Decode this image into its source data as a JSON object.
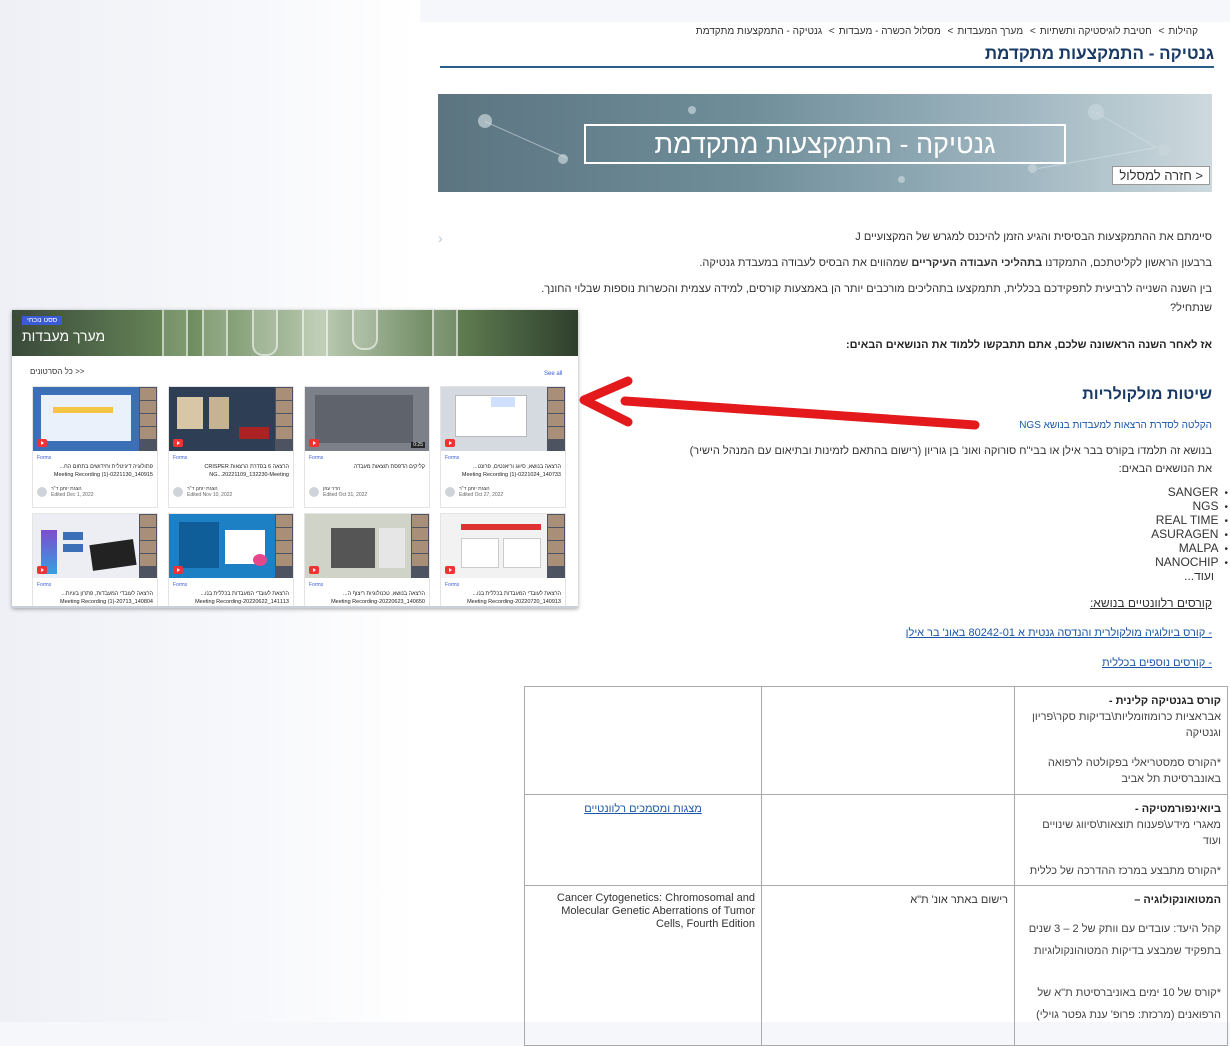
{
  "breadcrumb": [
    "קהילות",
    "חטיבת לוגיסטיקה ותשתיות",
    "מערך המעבדות",
    "מסלול הכשרה - מעבדות",
    "גנטיקה - התמקצעות מתקדמת"
  ],
  "page_title": "גנטיקה - התמקצעות מתקדמת",
  "banner": {
    "title": "גנטיקה - התמקצעות מתקדמת",
    "back_label": "< חזרה למסלול"
  },
  "intro": {
    "p1": "סיימתם את ההתמקצעות הבסיסית והגיע הזמן להיכנס למגרש של המקצועיים J",
    "p2_a": "ברבעון הראשון לקליטתכם, התמקדנו ",
    "p2_bold": "בתהליכי העבודה העיקריים",
    "p2_b": " שמהווים את הבסיס לעבודה במעבדת גנטיקה.",
    "p3": "בין השנה השנייה לרביעית לתפקידכם בכללית, תתמקצעו בתהליכים מורכבים יותר הן באמצעות קורסים, למידה עצמית והכשרות נוספות שבלוי החונך. שנתחיל?",
    "p4": "אז לאחר השנה הראשונה שלכם, אתם תתבקשו ללמוד את הנושאים הבאים:"
  },
  "section": {
    "title": "שיטות מולקולריות",
    "lecture_link": "הקלטה לסדרת הרצאות למעבדות בנושא NGS",
    "course_text_1": "בנושא זה תלמדו בקורס בבר אילן או בבי\"ח סורוקה ואונ' בן גוריון (רישום בהתאם לזמינות ובתיאום עם המנהל הישיר)",
    "course_text_2": "את הנושאים הבאים:",
    "techniques": [
      "SANGER",
      "NGS",
      "REAL TIME",
      "ASURAGEN",
      "MALPA",
      "NANOCHIP"
    ],
    "etc": "ועוד...",
    "relevant_courses": "קורסים רלוונטיים בנושא:",
    "course_link": "- קורס ביולוגיה מולקולרית והנדסה גנטית א 80242-01 באונ' בר אילן",
    "more_courses": "- קורסים נוספים בכללית"
  },
  "table": {
    "rows": [
      {
        "title": "קורס בגנטיקה קלינית -",
        "desc": "אבראציות כרומוזומליות\\בדיקות סקר\\פריון וגנטיקה",
        "note": "*הקורס סמסטריאלי בפקולטה לרפואה באונברסיטת תל אביב",
        "col2": "",
        "col3": ""
      },
      {
        "title": "ביואינפורמטיקה -",
        "desc": "מאגרי מידע\\פענוח תוצאות\\סיווג שינויים ועוד",
        "note": "*הקורס מתבצע במרכז ההדרכה של כללית",
        "col2": "",
        "col3": "מצגות ומסמכים רלוונטיים"
      },
      {
        "title": "המטואונקולוגיה –",
        "desc": "קהל היעד: עובדים עם וותק של 2 – 3 שנים בתפקיד שמבצע בדיקות המטוהונקולוגיות",
        "note": "*קורס של 10 ימים באוניברסיטת ת\"א של הרפואנים (מרכזת: פרופ' ענת גפטר גוילי)",
        "col2": "רישום באתר אונ' ת\"א",
        "col3": "Cancer Cytogenetics: Chromosomal and Molecular Genetic Aberrations of Tumor Cells, Fourth Edition"
      }
    ]
  },
  "overlay": {
    "badge": "ססט נוכחי",
    "title": "מערך מעבדות",
    "all_videos": "<< כל הסרטונים",
    "see_all": "See all",
    "cards": [
      {
        "tag": "Forms",
        "title": "הרצאה בנושא, סיווג וריאנטים, פרונט... 140733_0221024-Meeting Recording (1)",
        "author": "הצגת יוחנן ד\"ר",
        "edited": "Edited Oct 27, 2022",
        "duration": "",
        "thumb": "#d5d9e0"
      },
      {
        "tag": "Forms",
        "title": "קליקים הדפסת תוצאות מעבדה",
        "author": "הדר עוזן",
        "edited": "Edited Oct 31, 2022",
        "duration": "0:25",
        "thumb": "#7c8088"
      },
      {
        "tag": "Forms",
        "title": "הרצאה 6 בסדרת הרצאות CRISPER NG...20221109_132230-Meeting",
        "author": "הצגת יוחנן ד\"ר",
        "edited": "Edited Nov 10, 2022",
        "duration": "",
        "thumb": "#2e3e55"
      },
      {
        "tag": "Forms",
        "title": "פתולוגיה דיגיטלית וחידושים בתחום הח... 140915_0221130-Meeting Recording (1)",
        "author": "הצגת יוחנן ד\"ר",
        "edited": "Edited Dec 1, 2022",
        "duration": "",
        "thumb": "#3b6fb6"
      },
      {
        "tag": "Forms",
        "title": "הרצאת לעובדי המעבדות בכללית בנו... 140913_20220720-Meeting Recording",
        "author": "",
        "edited": "",
        "duration": "",
        "thumb": "#f2f2f2"
      },
      {
        "tag": "Forms",
        "title": "הרצאה בנושא, טכנולוגיות ריצוף ה... 140650_20220623-Meeting Recording",
        "author": "",
        "edited": "",
        "duration": "",
        "thumb": "#cfd3c8"
      },
      {
        "tag": "Forms",
        "title": "הרצאת לעובדי המעבדות בכללית בנו... 141113_20220622-Meeting Recording",
        "author": "",
        "edited": "",
        "duration": "",
        "thumb": "#1d7fc4"
      },
      {
        "tag": "Forms",
        "title": "הרצאה לעובדי המעבדות, פתרון בעיות... 140804_20713-Meeting Recording (1)",
        "author": "",
        "edited": "",
        "duration": "",
        "thumb": "#eceef3"
      }
    ]
  },
  "colors": {
    "accent": "#1a3a66",
    "link": "#1a57a8",
    "arrow": "#e3191c"
  }
}
